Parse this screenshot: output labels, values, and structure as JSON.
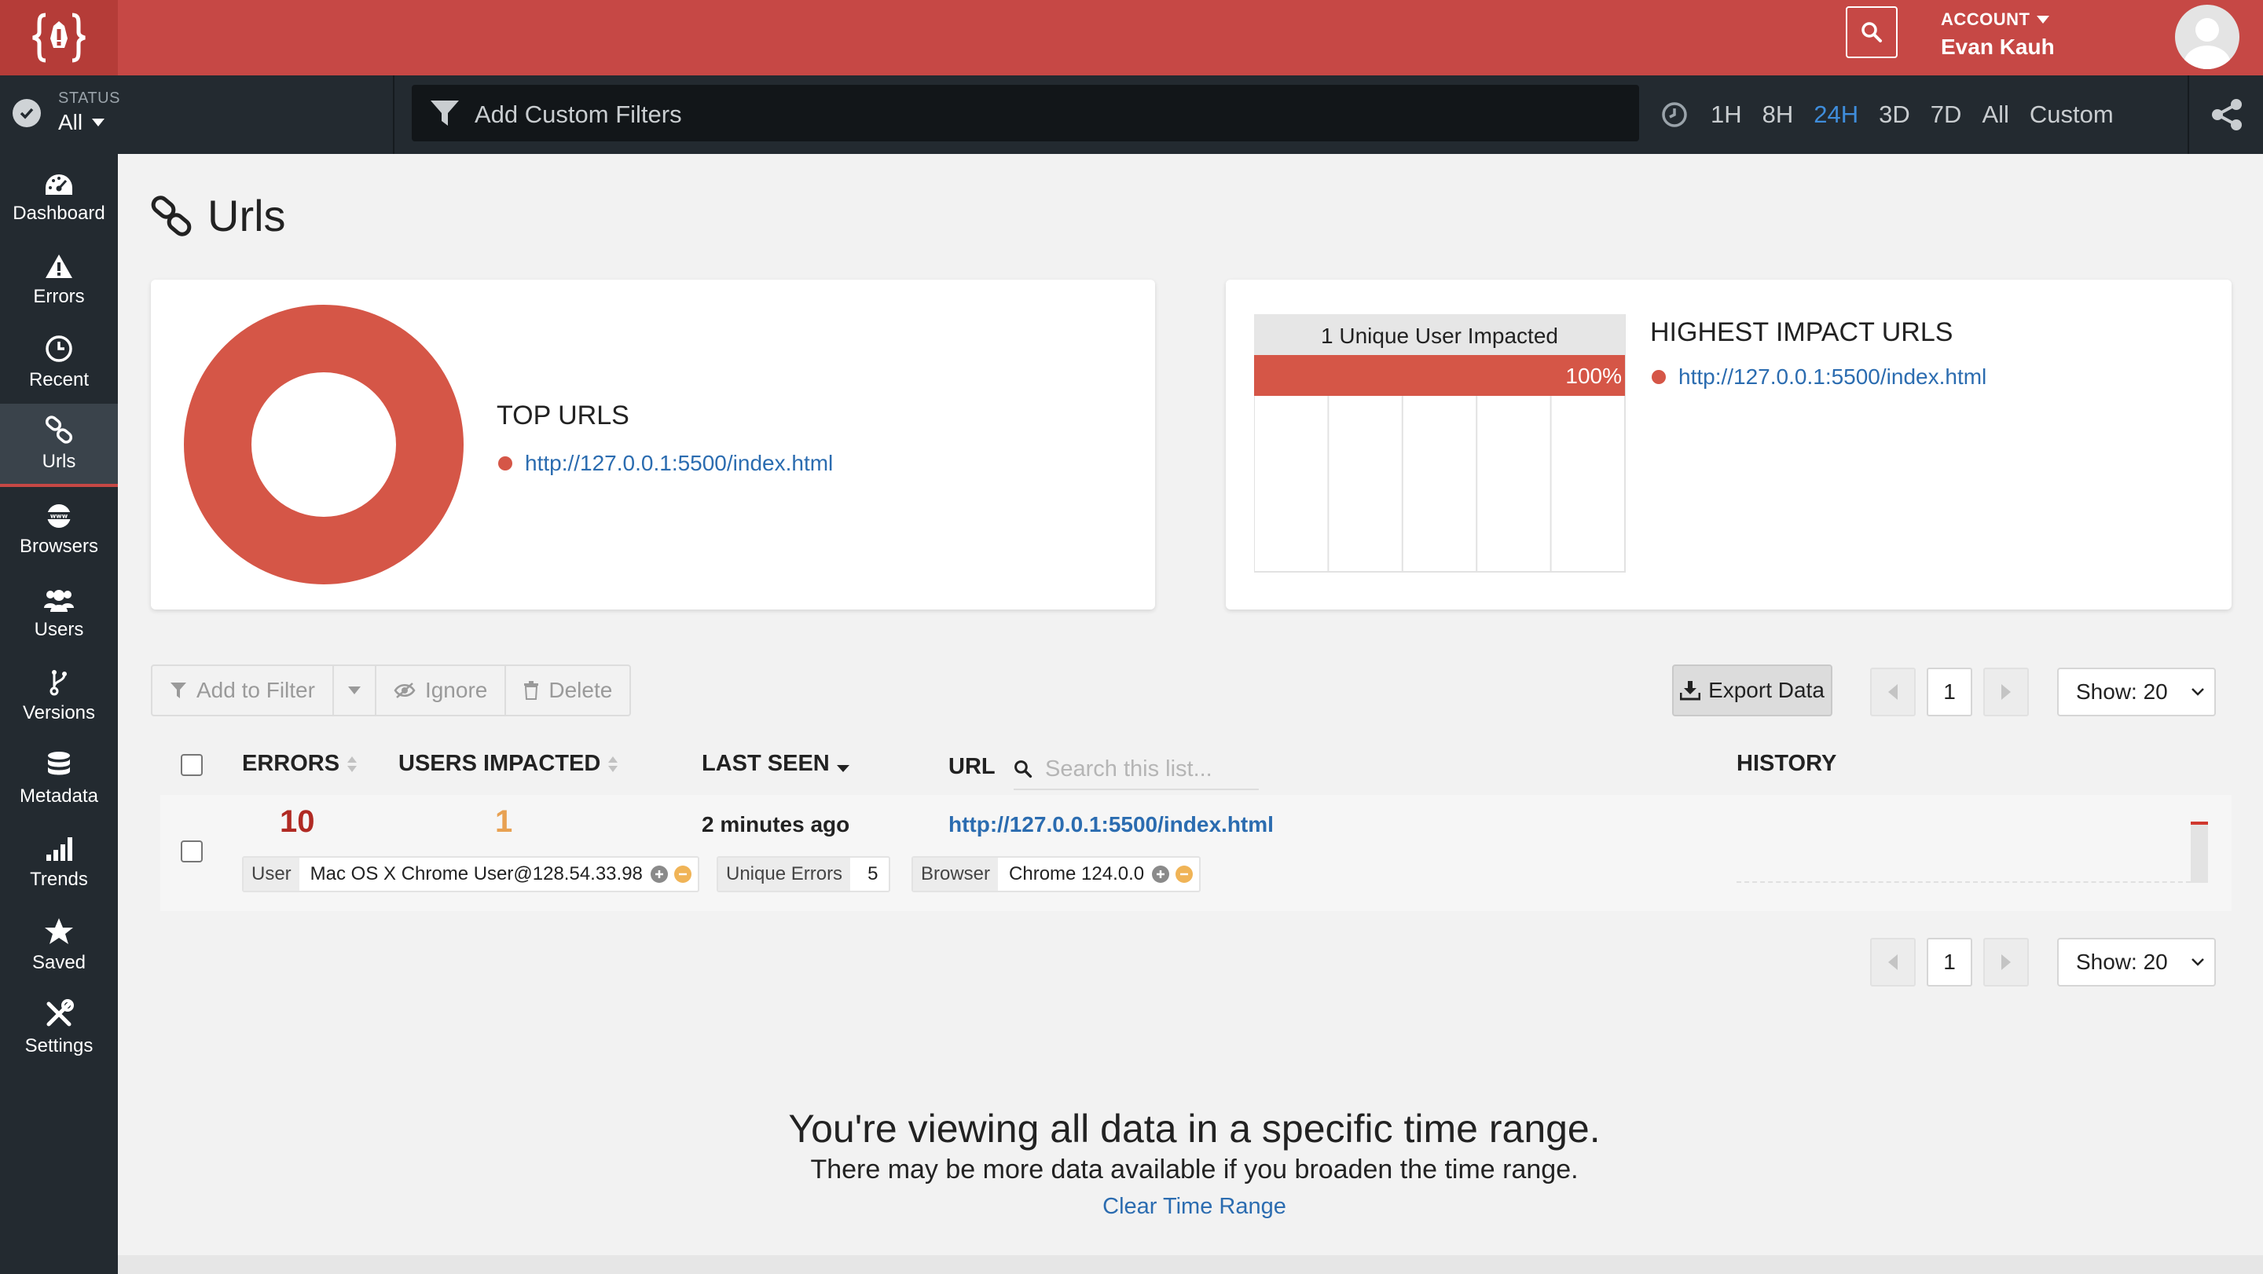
{
  "header": {
    "account_label": "ACCOUNT",
    "account_name": "Evan Kauh",
    "colors": {
      "brand": "#c64845",
      "dark": "#232a30",
      "link": "#2b6cb0",
      "active_range": "#3f8ddb"
    }
  },
  "toolbar": {
    "status_label": "STATUS",
    "status_value": "All",
    "filter_placeholder": "Add Custom Filters",
    "ranges": [
      "1H",
      "8H",
      "24H",
      "3D",
      "7D",
      "All",
      "Custom"
    ],
    "active_range": "24H"
  },
  "sidebar": {
    "items": [
      {
        "label": "Dashboard",
        "icon": "dashboard-gauge-icon"
      },
      {
        "label": "Errors",
        "icon": "warning-icon"
      },
      {
        "label": "Recent",
        "icon": "clock-icon"
      },
      {
        "label": "Urls",
        "icon": "link-icon",
        "active": true
      },
      {
        "label": "Browsers",
        "icon": "www-globe-icon"
      },
      {
        "label": "Users",
        "icon": "users-icon"
      },
      {
        "label": "Versions",
        "icon": "branch-icon"
      },
      {
        "label": "Metadata",
        "icon": "database-icon"
      },
      {
        "label": "Trends",
        "icon": "bar-chart-icon"
      },
      {
        "label": "Saved",
        "icon": "star-icon"
      },
      {
        "label": "Settings",
        "icon": "tools-icon"
      }
    ]
  },
  "page": {
    "title": "Urls"
  },
  "top_urls": {
    "title": "TOP URLS",
    "items": [
      "http://127.0.0.1:5500/index.html"
    ]
  },
  "highest_impact": {
    "title": "HIGHEST IMPACT URLS",
    "header": "1 Unique User Impacted",
    "percent_label": "100%",
    "items": [
      "http://127.0.0.1:5500/index.html"
    ]
  },
  "chart_data": [
    {
      "type": "pie",
      "title": "TOP URLS",
      "categories": [
        "http://127.0.0.1:5500/index.html"
      ],
      "values": [
        100
      ]
    },
    {
      "type": "bar",
      "title": "HIGHEST IMPACT URLS",
      "categories": [
        "http://127.0.0.1:5500/index.html"
      ],
      "values": [
        100
      ]
    }
  ],
  "actions": {
    "add_to_filter": "Add to Filter",
    "ignore": "Ignore",
    "delete": "Delete",
    "export": "Export Data"
  },
  "pagination": {
    "page": "1",
    "show": "Show: 20"
  },
  "table": {
    "headers": {
      "errors": "ERRORS",
      "users": "USERS IMPACTED",
      "last_seen": "LAST SEEN",
      "url": "URL",
      "history": "HISTORY"
    },
    "search_placeholder": "Search this list...",
    "rows": [
      {
        "errors": "10",
        "users": "1",
        "last_seen": "2 minutes ago",
        "url": "http://127.0.0.1:5500/index.html",
        "user_tag_key": "User",
        "user_tag_value": "Mac OS X Chrome User@128.54.33.98",
        "unique_key": "Unique Errors",
        "unique_value": "5",
        "browser_key": "Browser",
        "browser_value": "Chrome 124.0.0"
      }
    ]
  },
  "notice": {
    "heading": "You're viewing all data in a specific time range.",
    "text": "There may be more data available if you broaden the time range.",
    "link": "Clear Time Range"
  }
}
